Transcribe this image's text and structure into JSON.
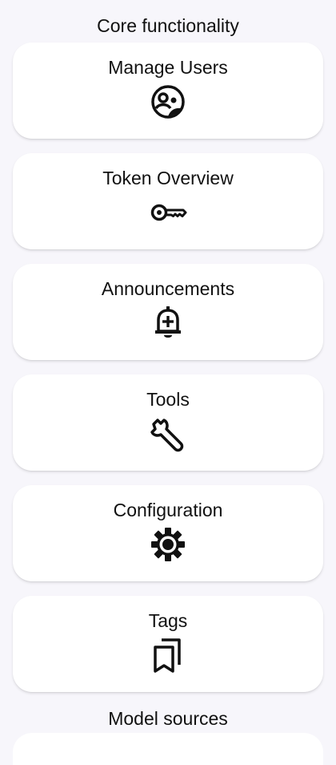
{
  "sections": {
    "core_title": "Core functionality",
    "model_sources_title": "Model sources"
  },
  "cards": [
    {
      "label": "Manage Users",
      "icon": "manage-users-icon"
    },
    {
      "label": "Token Overview",
      "icon": "key-icon"
    },
    {
      "label": "Announcements",
      "icon": "bell-plus-icon"
    },
    {
      "label": "Tools",
      "icon": "wrench-icon"
    },
    {
      "label": "Configuration",
      "icon": "gear-icon"
    },
    {
      "label": "Tags",
      "icon": "bookmarks-icon"
    }
  ],
  "colors": {
    "background": "#f7f6fb",
    "card": "#ffffff",
    "text": "#111111"
  }
}
